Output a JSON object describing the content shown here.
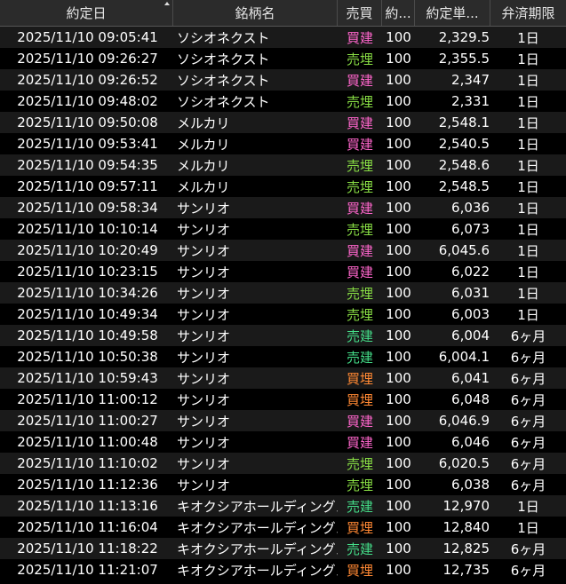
{
  "columns": {
    "date": "約定日",
    "name": "銘柄名",
    "side": "売買",
    "qty": "約...",
    "price": "約定単...",
    "term": "弁済期限"
  },
  "colors": {
    "buy_new": "#ff66cc",
    "sell_close": "#88dd44",
    "sell_new": "#44dd88",
    "buy_close": "#ff8833"
  },
  "rows": [
    {
      "date": "2025/11/10 09:05:41",
      "name": "ソシオネクスト",
      "side": "買建",
      "qty": "100",
      "price": "2,329.5",
      "term": "1日"
    },
    {
      "date": "2025/11/10 09:26:27",
      "name": "ソシオネクスト",
      "side": "売埋",
      "qty": "100",
      "price": "2,355.5",
      "term": "1日"
    },
    {
      "date": "2025/11/10 09:26:52",
      "name": "ソシオネクスト",
      "side": "買建",
      "qty": "100",
      "price": "2,347",
      "term": "1日"
    },
    {
      "date": "2025/11/10 09:48:02",
      "name": "ソシオネクスト",
      "side": "売埋",
      "qty": "100",
      "price": "2,331",
      "term": "1日"
    },
    {
      "date": "2025/11/10 09:50:08",
      "name": "メルカリ",
      "side": "買建",
      "qty": "100",
      "price": "2,548.1",
      "term": "1日"
    },
    {
      "date": "2025/11/10 09:53:41",
      "name": "メルカリ",
      "side": "買建",
      "qty": "100",
      "price": "2,540.5",
      "term": "1日"
    },
    {
      "date": "2025/11/10 09:54:35",
      "name": "メルカリ",
      "side": "売埋",
      "qty": "100",
      "price": "2,548.6",
      "term": "1日"
    },
    {
      "date": "2025/11/10 09:57:11",
      "name": "メルカリ",
      "side": "売埋",
      "qty": "100",
      "price": "2,548.5",
      "term": "1日"
    },
    {
      "date": "2025/11/10 09:58:34",
      "name": "サンリオ",
      "side": "買建",
      "qty": "100",
      "price": "6,036",
      "term": "1日"
    },
    {
      "date": "2025/11/10 10:10:14",
      "name": "サンリオ",
      "side": "売埋",
      "qty": "100",
      "price": "6,073",
      "term": "1日"
    },
    {
      "date": "2025/11/10 10:20:49",
      "name": "サンリオ",
      "side": "買建",
      "qty": "100",
      "price": "6,045.6",
      "term": "1日"
    },
    {
      "date": "2025/11/10 10:23:15",
      "name": "サンリオ",
      "side": "買建",
      "qty": "100",
      "price": "6,022",
      "term": "1日"
    },
    {
      "date": "2025/11/10 10:34:26",
      "name": "サンリオ",
      "side": "売埋",
      "qty": "100",
      "price": "6,031",
      "term": "1日"
    },
    {
      "date": "2025/11/10 10:49:34",
      "name": "サンリオ",
      "side": "売埋",
      "qty": "100",
      "price": "6,003",
      "term": "1日"
    },
    {
      "date": "2025/11/10 10:49:58",
      "name": "サンリオ",
      "side": "売建",
      "qty": "100",
      "price": "6,004",
      "term": "6ヶ月"
    },
    {
      "date": "2025/11/10 10:50:38",
      "name": "サンリオ",
      "side": "売建",
      "qty": "100",
      "price": "6,004.1",
      "term": "6ヶ月"
    },
    {
      "date": "2025/11/10 10:59:43",
      "name": "サンリオ",
      "side": "買埋",
      "qty": "100",
      "price": "6,041",
      "term": "6ヶ月"
    },
    {
      "date": "2025/11/10 11:00:12",
      "name": "サンリオ",
      "side": "買埋",
      "qty": "100",
      "price": "6,048",
      "term": "6ヶ月"
    },
    {
      "date": "2025/11/10 11:00:27",
      "name": "サンリオ",
      "side": "買建",
      "qty": "100",
      "price": "6,046.9",
      "term": "6ヶ月"
    },
    {
      "date": "2025/11/10 11:00:48",
      "name": "サンリオ",
      "side": "買建",
      "qty": "100",
      "price": "6,046",
      "term": "6ヶ月"
    },
    {
      "date": "2025/11/10 11:10:02",
      "name": "サンリオ",
      "side": "売埋",
      "qty": "100",
      "price": "6,020.5",
      "term": "6ヶ月"
    },
    {
      "date": "2025/11/10 11:12:36",
      "name": "サンリオ",
      "side": "売埋",
      "qty": "100",
      "price": "6,038",
      "term": "6ヶ月"
    },
    {
      "date": "2025/11/10 11:13:16",
      "name": "キオクシアホールディングス",
      "side": "売建",
      "qty": "100",
      "price": "12,970",
      "term": "1日"
    },
    {
      "date": "2025/11/10 11:16:04",
      "name": "キオクシアホールディングス",
      "side": "買埋",
      "qty": "100",
      "price": "12,840",
      "term": "1日"
    },
    {
      "date": "2025/11/10 11:18:22",
      "name": "キオクシアホールディングス",
      "side": "売建",
      "qty": "100",
      "price": "12,825",
      "term": "6ヶ月"
    },
    {
      "date": "2025/11/10 11:21:07",
      "name": "キオクシアホールディングス",
      "side": "買埋",
      "qty": "100",
      "price": "12,735",
      "term": "6ヶ月"
    }
  ]
}
